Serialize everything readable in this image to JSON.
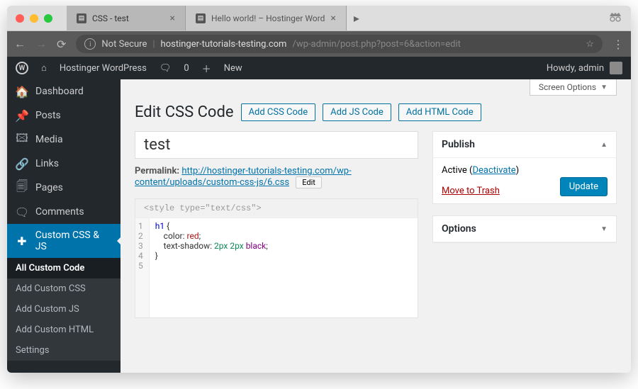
{
  "browser": {
    "tab1": "CSS - test",
    "tab2": "Hello world! – Hostinger Word",
    "not_secure": "Not Secure",
    "domain": "hostinger-tutorials-testing.com",
    "path": "/wp-admin/post.php?post=6&action=edit"
  },
  "wpbar": {
    "site": "Hostinger WordPress",
    "comments": "0",
    "new": "New",
    "howdy": "Howdy, admin"
  },
  "sidebar": {
    "dashboard": "Dashboard",
    "posts": "Posts",
    "media": "Media",
    "links": "Links",
    "pages": "Pages",
    "comments": "Comments",
    "custom": "Custom CSS & JS",
    "sub": {
      "all": "All Custom Code",
      "css": "Add Custom CSS",
      "js": "Add Custom JS",
      "html": "Add Custom HTML",
      "settings": "Settings"
    }
  },
  "screen_options": "Screen Options",
  "header": {
    "title": "Edit CSS Code",
    "btn_css": "Add CSS Code",
    "btn_js": "Add JS Code",
    "btn_html": "Add HTML Code"
  },
  "post": {
    "title": "test",
    "permalink_label": "Permalink:",
    "permalink_url": "http://hostinger-tutorials-testing.com/wp-content/uploads/custom-css-js/6.css",
    "edit": "Edit",
    "editor_header": "<style type=\"text/css\">",
    "code_lines": [
      "h1 {",
      "    color: red;",
      "    text-shadow: 2px 2px black;",
      "}",
      ""
    ]
  },
  "publish": {
    "heading": "Publish",
    "active": "Active",
    "deactivate": "Deactivate",
    "trash": "Move to Trash",
    "update": "Update"
  },
  "options": {
    "heading": "Options"
  }
}
